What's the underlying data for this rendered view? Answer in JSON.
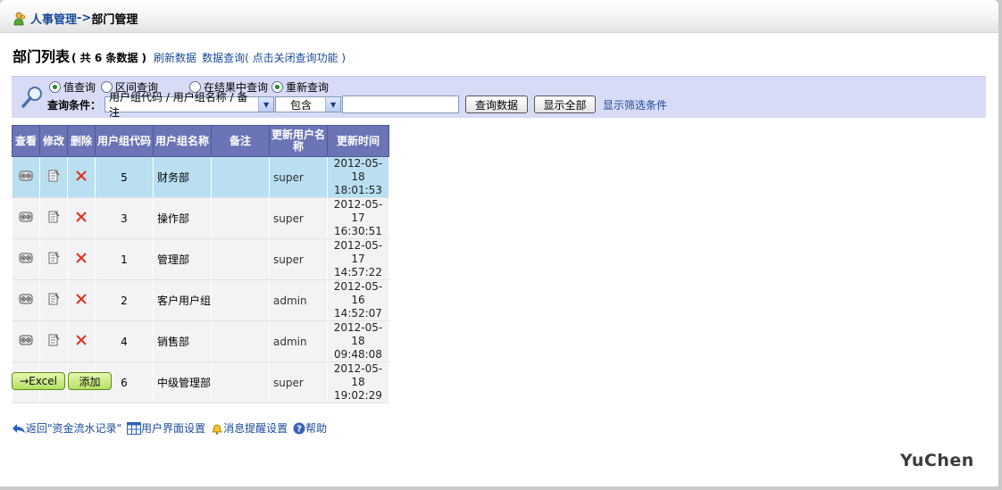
{
  "breadcrumb": {
    "section": "人事管理",
    "separator": "->",
    "current": "部门管理"
  },
  "list_header": {
    "title": "部门列表",
    "count": "( 共 6 条数据 )",
    "refresh": "刷新数据",
    "query": "数据查询",
    "close_query": "( 点击关闭查询功能 )"
  },
  "search": {
    "radios": [
      {
        "label": "值查询",
        "checked": true
      },
      {
        "label": "区间查询",
        "checked": false
      },
      {
        "label": "在结果中查询",
        "checked": false
      },
      {
        "label": "重新查询",
        "checked": true
      }
    ],
    "condition_label": "查询条件：",
    "field_select": "用户组代码 / 用户组名称 / 备注",
    "op_select": "包含",
    "input_value": "",
    "query_button": "查询数据",
    "show_all_button": "显示全部",
    "filter_link": "显示筛选条件"
  },
  "table": {
    "headers": [
      "查看",
      "修改",
      "删除",
      "用户组代码",
      "用户组名称",
      "备注",
      "更新用户名称",
      "更新时间"
    ],
    "rows": [
      {
        "code": "5",
        "name": "财务部",
        "note": "",
        "user": "super",
        "date": "2012-05-18",
        "time": "18:01:53",
        "selected": true
      },
      {
        "code": "3",
        "name": "操作部",
        "note": "",
        "user": "super",
        "date": "2012-05-17",
        "time": "16:30:51",
        "selected": false
      },
      {
        "code": "1",
        "name": "管理部",
        "note": "",
        "user": "super",
        "date": "2012-05-17",
        "time": "14:57:22",
        "selected": false
      },
      {
        "code": "2",
        "name": "客户用户组",
        "note": "",
        "user": "admin",
        "date": "2012-05-16",
        "time": "14:52:07",
        "selected": false
      },
      {
        "code": "4",
        "name": "销售部",
        "note": "",
        "user": "admin",
        "date": "2012-05-18",
        "time": "09:48:08",
        "selected": false
      },
      {
        "code": "6",
        "name": "中级管理部",
        "note": "",
        "user": "super",
        "date": "2012-05-18",
        "time": "19:02:29",
        "selected": false
      }
    ]
  },
  "actions": {
    "excel": "→Excel",
    "add": "添加"
  },
  "footer": {
    "back": "返回\"资金流水记录\"",
    "ui_settings": "用户界面设置",
    "notify_settings": "消息提醒设置",
    "help": "帮助"
  },
  "brand": "YuChen",
  "colors": {
    "header_bg": "#6b75b5",
    "panel_bg": "#d7dbf5",
    "selected_row": "#b9dff0",
    "link": "#1a4a9a",
    "delete": "#e0321c"
  }
}
